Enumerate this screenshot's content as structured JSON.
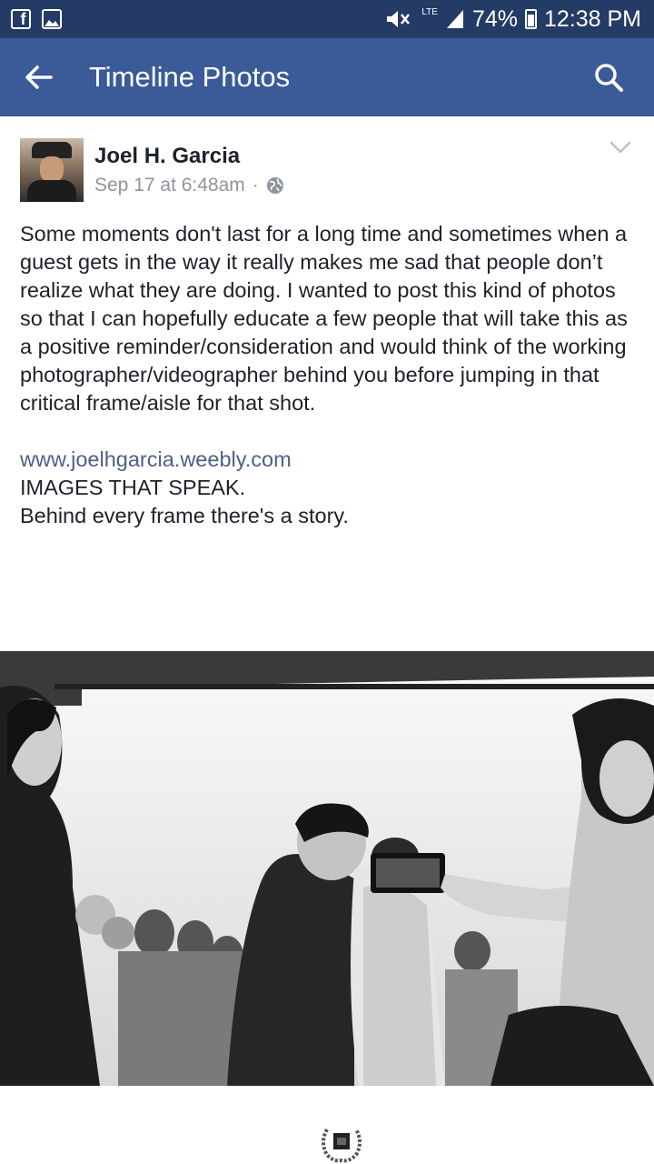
{
  "status_bar": {
    "battery": "74%",
    "time": "12:38 PM",
    "network": "LTE",
    "left_icons": [
      "facebook-icon",
      "gallery-icon"
    ],
    "right_icons": [
      "mute-icon",
      "signal-icon",
      "battery-charging-icon"
    ]
  },
  "app_bar": {
    "title": "Timeline Photos",
    "back_icon": "arrow-left-icon",
    "search_icon": "search-icon",
    "color": "#3b5a98"
  },
  "post": {
    "author": "Joel H. Garcia",
    "date": "Sep 17 at 6:48am",
    "separator": "·",
    "privacy_icon": "globe-icon",
    "menu_icon": "chevron-down-icon",
    "body": "Some moments don't last for a long time and sometimes when a guest gets in the way it really makes me sad that people don’t realize what they are doing. I wanted to post this kind of photos so that I can hopefully educate a few people that will take this as a positive reminder/consideration and would think of the working photographer/videographer behind you before jumping in that critical frame/aisle for that shot.",
    "link": "www.joelhgarcia.weebly.com",
    "tagline_1": "IMAGES THAT SPEAK.",
    "tagline_2": "Behind every frame there's a story.",
    "photo_subject": "wedding-photo",
    "footer_icon": "laurel-logo-icon"
  }
}
